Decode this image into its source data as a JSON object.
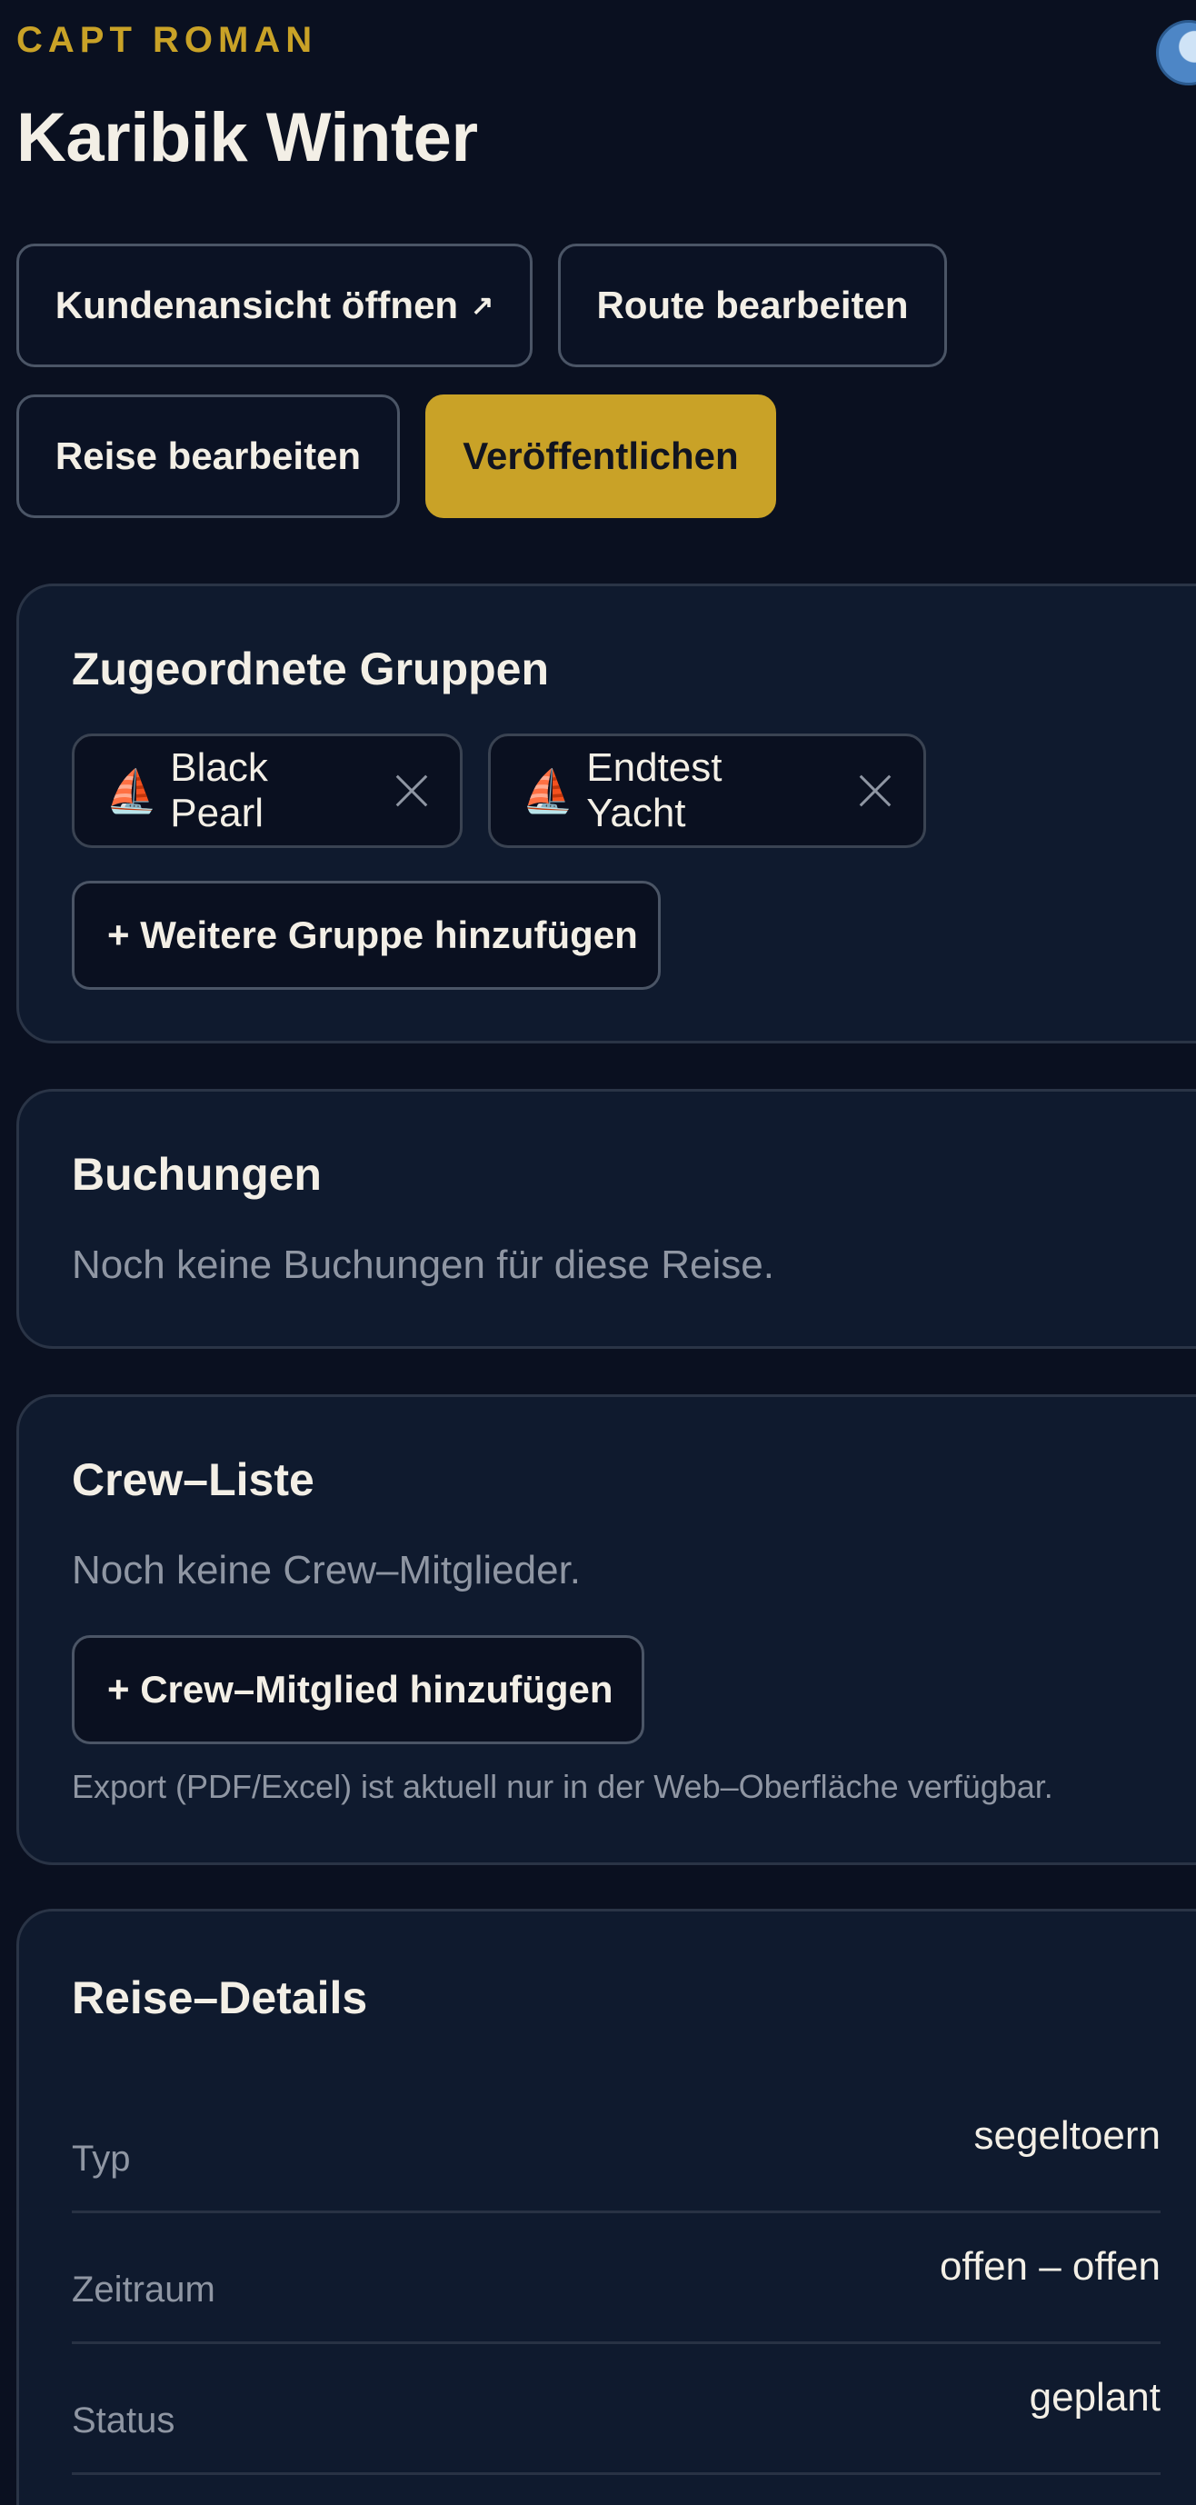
{
  "header": {
    "brand": "CAPT ROMAN",
    "title": "Karibik Winter"
  },
  "actions": {
    "customer_view": "Kundenansicht öffnen",
    "customer_view_icon": "↗",
    "edit_route": "Route bearbeiten",
    "edit_trip": "Reise bearbeiten",
    "publish": "Veröffentlichen"
  },
  "groups": {
    "title": "Zugeordnete Gruppen",
    "items": [
      {
        "icon": "⛵",
        "label": "Black Pearl"
      },
      {
        "icon": "⛵",
        "label": "Endtest Yacht"
      }
    ],
    "add_label": "+ Weitere Gruppe hinzufügen"
  },
  "bookings": {
    "title": "Buchungen",
    "empty": "Noch keine Buchungen für diese Reise."
  },
  "crew": {
    "title": "Crew–Liste",
    "empty": "Noch keine Crew–Mitglieder.",
    "add_label": "+ Crew–Mitglied hinzufügen",
    "export_note": "Export (PDF/Excel) ist aktuell nur in der Web–Oberfläche verfügbar."
  },
  "details": {
    "title": "Reise–Details",
    "rows": [
      {
        "label": "Typ",
        "value": "segeltoern"
      },
      {
        "label": "Zeitraum",
        "value": "offen – offen"
      },
      {
        "label": "Status",
        "value": "geplant"
      }
    ]
  },
  "colors": {
    "background": "#0a1020",
    "card": "#0f1a2e",
    "accent": "#c9a227",
    "muted_text": "#8f96a3"
  }
}
